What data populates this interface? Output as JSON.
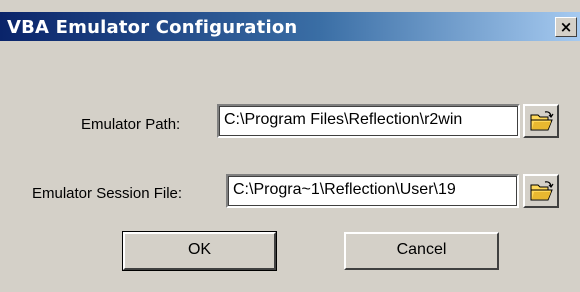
{
  "window": {
    "title": "VBA Emulator Configuration",
    "close_glyph": "×"
  },
  "form": {
    "emulator_path": {
      "label": "Emulator Path:",
      "value": "C:\\Program Files\\Reflection\\r2win"
    },
    "session_file": {
      "label": "Emulator Session File:",
      "value": "C:\\Progra~1\\Reflection\\User\\19"
    },
    "browse_icon": "open-folder-icon"
  },
  "buttons": {
    "ok_label": "OK",
    "cancel_label": "Cancel"
  },
  "colors": {
    "dialog_face": "#d4d0c8",
    "title_start": "#0a246a",
    "title_end": "#a6caf0",
    "folder_yellow": "#ffd95a"
  }
}
